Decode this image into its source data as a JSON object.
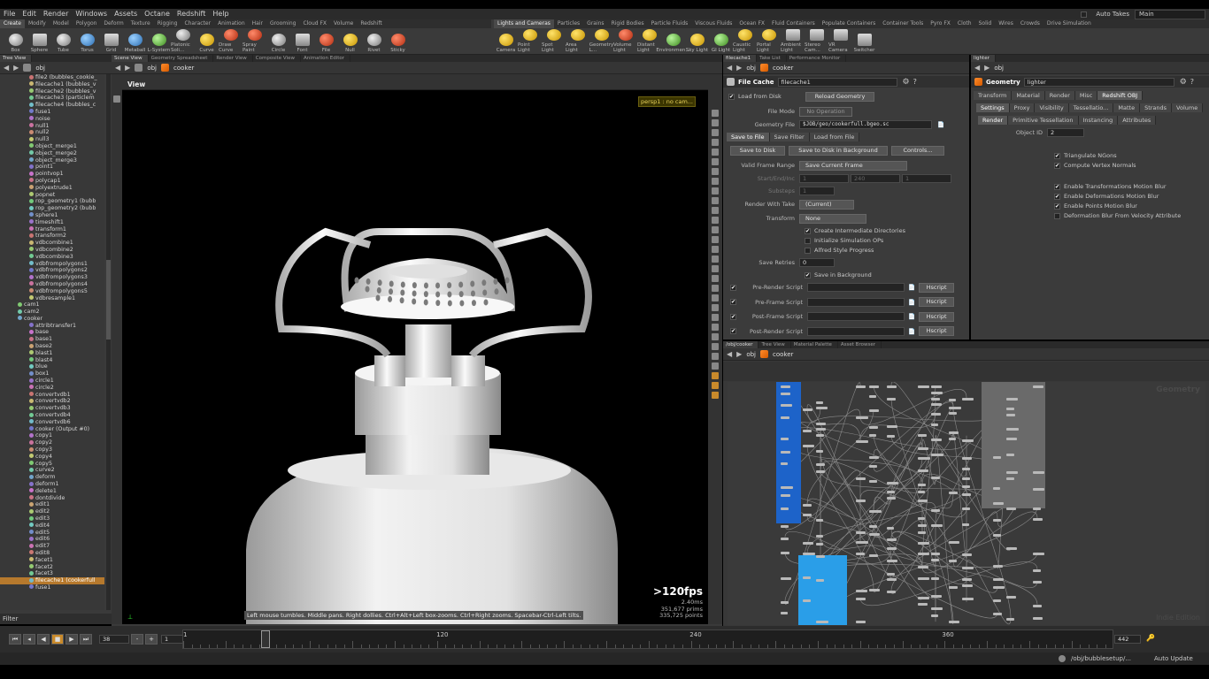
{
  "menubar": {
    "items": [
      "File",
      "Edit",
      "Render",
      "Windows",
      "Assets",
      "Octane",
      "Redshift",
      "Help"
    ],
    "auto_takes": "Auto Takes",
    "desktop": "Main"
  },
  "shelf": {
    "left_tabs": [
      "Create",
      "Modify",
      "Model",
      "Polygon",
      "Deform",
      "Texture",
      "Rigging",
      "Character",
      "Animation",
      "Hair",
      "Grooming",
      "Cloud FX",
      "Volume",
      "Redshift"
    ],
    "right_tabs": [
      "Lights and Cameras",
      "Particles",
      "Grains",
      "Rigid Bodies",
      "Particle Fluids",
      "Viscous Fluids",
      "Ocean FX",
      "Fluid Containers",
      "Populate Containers",
      "Container Tools",
      "Pyro FX",
      "Cloth",
      "Solid",
      "Wires",
      "Crowds",
      "Drive Simulation"
    ],
    "left_tools": [
      "Box",
      "Sphere",
      "Tube",
      "Torus",
      "Grid",
      "Metaball",
      "L-System",
      "Platonic Soli...",
      "Curve",
      "Draw Curve",
      "Spray Paint",
      "Circle",
      "Font",
      "File",
      "Null",
      "Rivet",
      "Sticky"
    ],
    "right_tools": [
      "Camera",
      "Point Light",
      "Spot Light",
      "Area Light",
      "Geometry L...",
      "Volume Light",
      "Distant Light",
      "Environmen...",
      "Sky Light",
      "GI Light",
      "Caustic Light",
      "Portal Light",
      "Ambient Light",
      "Stereo Cam...",
      "VR Camera",
      "Switcher"
    ]
  },
  "tree": {
    "tab": "Tree View",
    "path": "obj",
    "filter_label": "Filter",
    "items": [
      "file2 (bubbles_cookie_",
      "filecache1 (bubbles_v",
      "filecache2 (bubbles_v",
      "filecache3 (particlem",
      "filecache4 (bubbles_c",
      "fuse1",
      "noise",
      "null1",
      "null2",
      "null3",
      "object_merge1",
      "object_merge2",
      "object_merge3",
      "point1",
      "pointvop1",
      "polycap1",
      "polyextrude1",
      "popnet",
      "rop_geometry1 (bubb",
      "rop_geometry2 (bubb",
      "sphere1",
      "timeshift1",
      "transform1",
      "transform2",
      "vdbcombine1",
      "vdbcombine2",
      "vdbcombine3",
      "vdbfrompolygons1",
      "vdbfrompolygons2",
      "vdbfrompolygons3",
      "vdbfrompolygons4",
      "vdbfrompolygons5",
      "vdbresample1",
      "cam1",
      "cam2",
      "cooker",
      "attribtransfer1",
      "base",
      "base1",
      "base2",
      "blast1",
      "blast4",
      "blue",
      "box1",
      "circle1",
      "circle2",
      "convertvdb1",
      "convertvdb2",
      "convertvdb3",
      "convertvdb4",
      "convertvdb6",
      "cooker (Output #0)",
      "copy1",
      "copy2",
      "copy3",
      "copy4",
      "copy5",
      "curve2",
      "deform",
      "deform1",
      "delete1",
      "dontdivide",
      "edit1",
      "edit2",
      "edit3",
      "edit4",
      "edit5",
      "edit6",
      "edit7",
      "edit8",
      "facet1",
      "facet2",
      "facet3",
      "filecache1 (cookerfull",
      "fuse1"
    ],
    "selected_index": 73
  },
  "viewer": {
    "tabs": [
      "Scene View",
      "Geometry Spreadsheet",
      "Render View",
      "Composite View",
      "Animation Editor"
    ],
    "path_obj": "obj",
    "path_node": "cooker",
    "view_label": "View",
    "cam_tag": "persp1 : no cam...",
    "fps": ">120fps",
    "ms": "2.40ms",
    "prims_label": "351,677 prims",
    "points_label": "335,725 points",
    "hint": "Left mouse tumbles. Middle pans. Right dollies. Ctrl+Alt+Left box-zooms. Ctrl+Right zooms. Spacebar-Ctrl-Left tilts."
  },
  "params": {
    "tabs": [
      "filecache1",
      "Take List",
      "Performance Monitor"
    ],
    "path_obj": "obj",
    "path_node": "cooker",
    "node_type": "File Cache",
    "node_name": "filecache1",
    "load_from_disk": "Load from Disk",
    "reload": "Reload Geometry",
    "file_mode_label": "File Mode",
    "file_mode": "No Operation",
    "geo_file_label": "Geometry File",
    "geo_file": "$JOB/geo/cookerfull.bgeo.sc",
    "subtabs": [
      "Save to File",
      "Save Filter",
      "Load from File"
    ],
    "save_to_disk": "Save to Disk",
    "save_bg": "Save to Disk in Background",
    "controls": "Controls...",
    "frame_range_label": "Valid Frame Range",
    "frame_range": "Save Current Frame",
    "start_label": "Start/End/Inc",
    "start_vals": [
      "1",
      "240",
      "1"
    ],
    "substeps_label": "Substeps",
    "substeps": "1",
    "take_label": "Render With Take",
    "take": "(Current)",
    "transform_label": "Transform",
    "transform": "None",
    "checks": [
      "Create Intermediate Directories",
      "Initialize Simulation OPs",
      "Alfred Style Progress"
    ],
    "retries_label": "Save Retries",
    "retries": "0",
    "save_in_bg": "Save in Background",
    "scripts": [
      "Pre-Render Script",
      "Pre-Frame Script",
      "Post-Frame Script",
      "Post-Render Script"
    ],
    "hscript": "Hscript"
  },
  "lighter": {
    "tab": "lighter",
    "path_obj": "obj",
    "node_type": "Geometry",
    "node_name": "lighter",
    "tabs1": [
      "Transform",
      "Material",
      "Render",
      "Misc",
      "Redshift OBJ"
    ],
    "tabs2": [
      "Settings",
      "Proxy",
      "Visibility",
      "Tessellatio...",
      "Matte",
      "Strands",
      "Volume"
    ],
    "tabs3": [
      "Render",
      "Primitive Tessellation",
      "Instancing",
      "Attributes"
    ],
    "object_id_label": "Object ID",
    "object_id": "2",
    "checks": [
      "Triangulate NGons",
      "Compute Vertex Normals",
      "Enable Transformations Motion Blur",
      "Enable Deformations Motion Blur",
      "Enable Points Motion Blur",
      "Deformation Blur From Velocity Attribute"
    ],
    "checks_on": [
      true,
      true,
      true,
      true,
      true,
      false
    ]
  },
  "network": {
    "tabs": [
      "/obj/cooker",
      "Tree View",
      "Material Palette",
      "Asset Browser"
    ],
    "path_obj": "obj",
    "path_node": "cooker",
    "context": "Geometry",
    "watermark": "Indie Edition"
  },
  "timeline": {
    "frame": "38",
    "start": "1",
    "end": "442",
    "ticks": [
      "1",
      "38",
      "120",
      "240",
      "360"
    ]
  },
  "status": {
    "path": "/obj/bubblesetup/...",
    "auto_update": "Auto Update"
  },
  "colors": {
    "accent": "#ff8b2b",
    "selection": "#b6792d",
    "blue_node": "#1d63c9",
    "cyan_node": "#2a9ee8"
  }
}
